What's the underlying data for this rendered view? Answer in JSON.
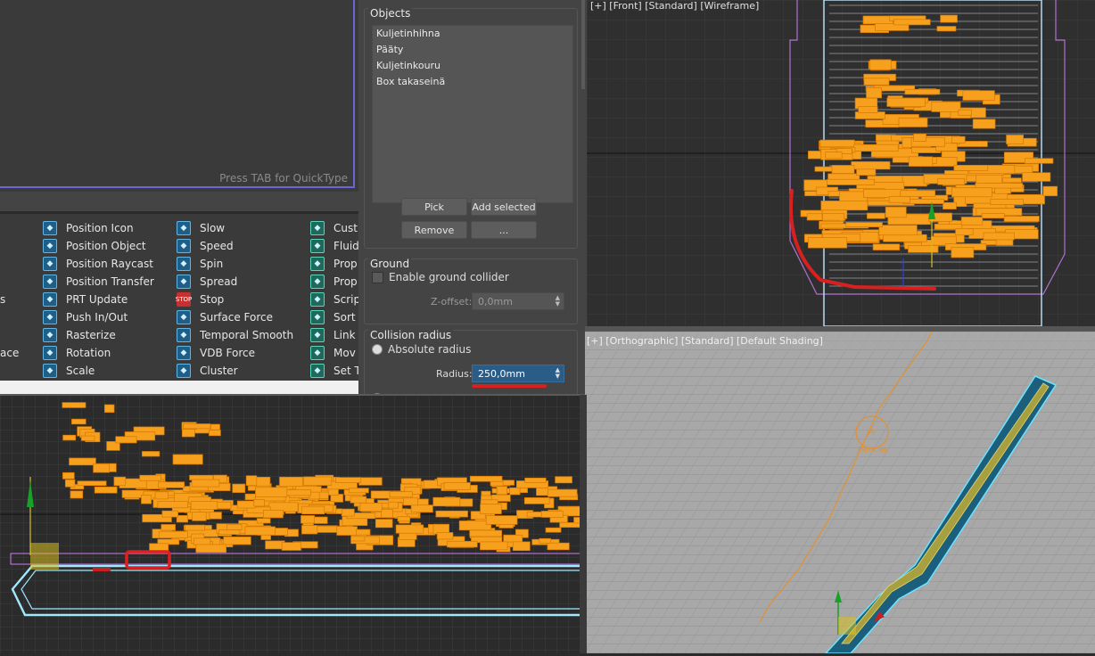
{
  "flow_editor": {
    "hint": "Press TAB for QuickType"
  },
  "depot": {
    "col0": [
      "s",
      "ace"
    ],
    "col1": [
      "Position Icon",
      "Position Object",
      "Position Raycast",
      "Position Transfer",
      "PRT Update",
      "Push In/Out",
      "Rasterize",
      "Rotation",
      "Scale"
    ],
    "col2": [
      "Slow",
      "Speed",
      "Spin",
      "Spread",
      "Stop",
      "Surface Force",
      "Temporal Smooth",
      "VDB Force",
      "Cluster"
    ],
    "col3": [
      "Cust",
      "Fluid",
      "Prop",
      "Prop",
      "Scrip",
      "Sort",
      "Link",
      "Mov",
      "Set T"
    ],
    "icons1": [
      "position-icon-icon",
      "position-object-icon",
      "position-raycast-icon",
      "position-transfer-icon",
      "prt-update-icon",
      "push-in-out-icon",
      "rasterize-icon",
      "rotation-icon",
      "scale-icon"
    ],
    "icons2": [
      "slow-icon",
      "speed-icon",
      "spin-icon",
      "spread-icon",
      "stop-icon",
      "surface-force-icon",
      "temporal-smooth-icon",
      "vdb-force-icon",
      "cluster-icon"
    ],
    "icons3": [
      "custom-icon",
      "fluid-icon",
      "property-icon",
      "property-icon",
      "script-icon",
      "sort-icon",
      "link-icon",
      "move-icon",
      "set-icon"
    ]
  },
  "panel": {
    "objects_title": "Objects",
    "objects": [
      "Kuljetinhihna",
      "Pääty",
      "Kuljetinkouru",
      "Box takaseinä"
    ],
    "pick": "Pick",
    "add_selected": "Add selected",
    "remove": "Remove",
    "more": "...",
    "ground_title": "Ground",
    "enable_ground": "Enable ground collider",
    "zoffset_label": "Z-offset:",
    "zoffset_value": "0,0mm",
    "collision_title": "Collision radius",
    "absolute_radius": "Absolute radius",
    "radius_label": "Radius:",
    "radius_value": "250,0mm"
  },
  "viewports": {
    "front": "[+] [Front] [Standard] [Wireframe]",
    "ortho": "[+] [Orthographic] [Standard] [Default Shading]",
    "ortho_icon_text": "Particles"
  },
  "colors": {
    "particles": "#f7a01e",
    "selection": "#6f63d8",
    "annotation": "#d92020",
    "conveyor": "#1b5f7c",
    "belt": "#a8a040"
  }
}
